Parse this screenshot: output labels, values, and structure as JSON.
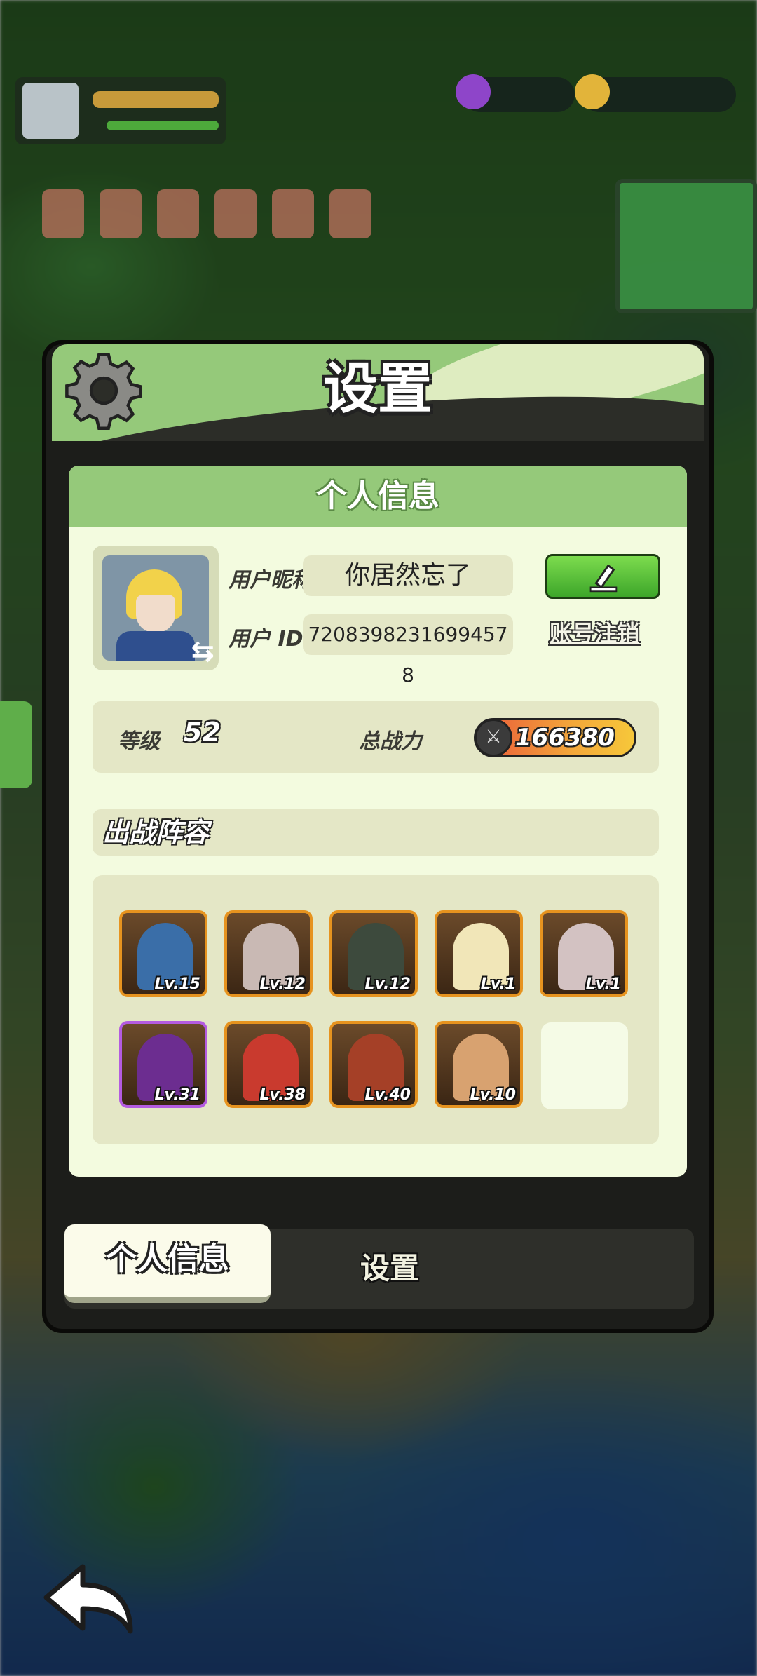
{
  "dialog": {
    "title": "设置"
  },
  "personal_info": {
    "header": "个人信息",
    "nickname_label": "用户昵称",
    "nickname": "你居然忘了",
    "id_label": "用户 ID",
    "user_id": "7208398231699457​8",
    "cancel_account": "账号注销",
    "level_label": "等级",
    "level": "52",
    "power_label": "总战力",
    "power": "166380"
  },
  "lineup": {
    "header": "出战阵容",
    "heroes": [
      {
        "level": "Lv.15",
        "color": "#3a6ea8"
      },
      {
        "level": "Lv.12",
        "color": "#c9b9b4"
      },
      {
        "level": "Lv.12",
        "color": "#3d4a3d"
      },
      {
        "level": "Lv.1",
        "color": "#f1e6b8"
      },
      {
        "level": "Lv.1",
        "color": "#d3c2c2"
      },
      {
        "level": "Lv.31",
        "color": "#6c2d90"
      },
      {
        "level": "Lv.38",
        "color": "#c93a2e"
      },
      {
        "level": "Lv.40",
        "color": "#a54027"
      },
      {
        "level": "Lv.10",
        "color": "#d8a270"
      }
    ]
  },
  "tabs": {
    "active": "个人信息",
    "other": "设置"
  },
  "icons": {
    "settings": "gear-icon",
    "edit": "edit-icon",
    "swap": "swap-icon",
    "power": "swords-icon",
    "back": "back-arrow-icon"
  }
}
